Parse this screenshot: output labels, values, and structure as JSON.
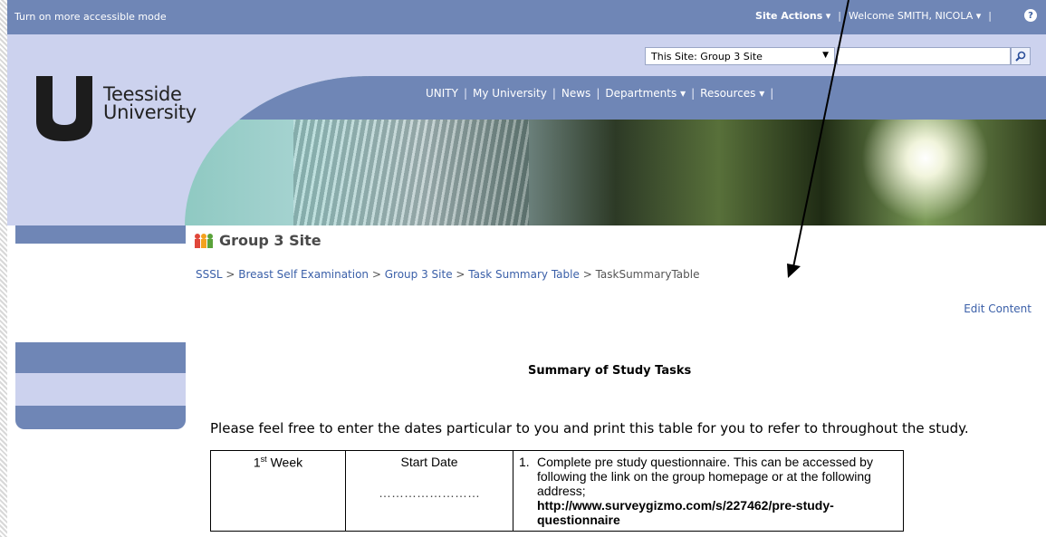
{
  "topbar": {
    "accessible_mode": "Turn on more accessible mode",
    "site_actions": "Site Actions",
    "welcome": "Welcome SMITH, NICOLA",
    "help": "?"
  },
  "search": {
    "scope": "This Site: Group 3 Site",
    "placeholder": ""
  },
  "logo": {
    "line1": "Teesside",
    "line2": "University"
  },
  "nav": {
    "items": [
      "UNITY",
      "My University",
      "News",
      "Departments",
      "Resources"
    ]
  },
  "page": {
    "title": "Group 3 Site",
    "edit_content": "Edit Content"
  },
  "breadcrumb": {
    "items": [
      "SSSL",
      "Breast Self Examination",
      "Group 3 Site",
      "Task Summary Table"
    ],
    "current": "TaskSummaryTable"
  },
  "content": {
    "summary_title": "Summary of Study Tasks",
    "intro": "Please feel free to enter the dates particular to you and print this table for you to refer to throughout the study.",
    "table": {
      "week_prefix": "1",
      "week_suffix": "st",
      "week_word": "Week",
      "start_date_label": "Start Date",
      "date_placeholder": "……………………",
      "task_number": "1.",
      "task_text": "Complete pre study questionnaire. This can be accessed by following the link on the group homepage or  at the following address;",
      "task_url": "http://www.surveygizmo.com/s/227462/pre-study-questionnaire"
    }
  },
  "colors": {
    "topbar": "#6f86b6",
    "header_bg": "#ccd2ee",
    "link": "#3a5fa8"
  }
}
